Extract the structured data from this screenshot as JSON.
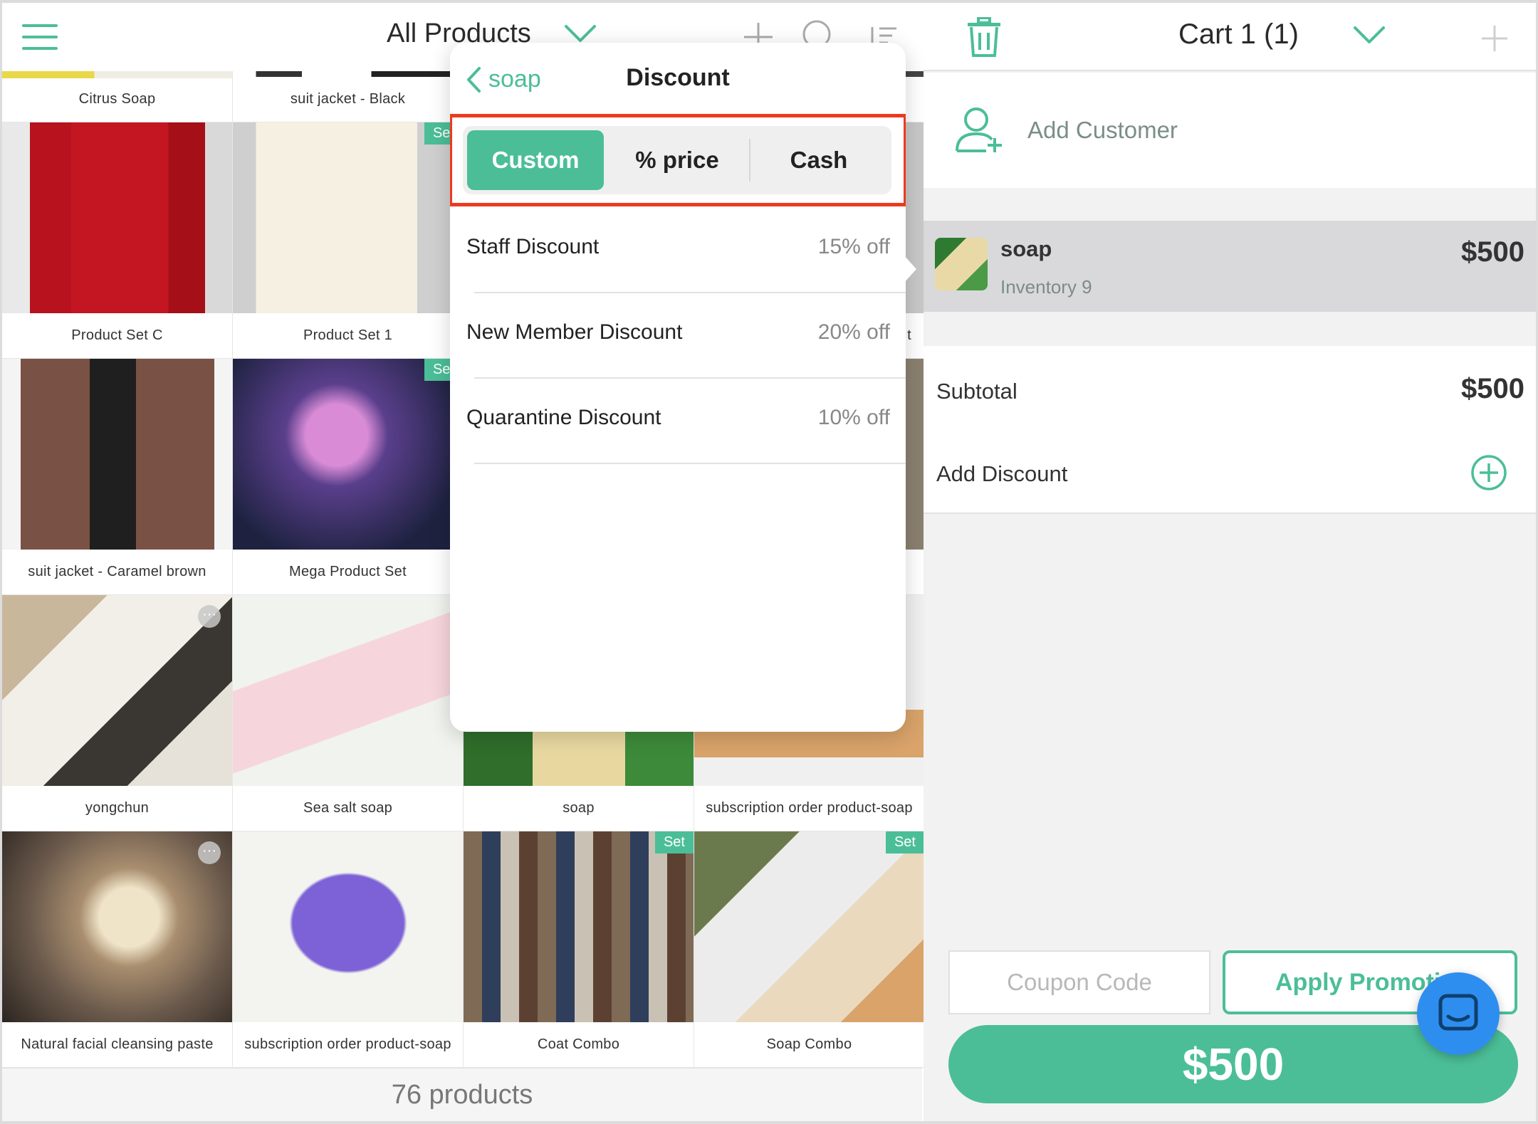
{
  "colors": {
    "accent": "#4bbe98",
    "highlight": "#ec3a1e",
    "chat": "#2e8ef0"
  },
  "header": {
    "title": "All Products",
    "icons": [
      "menu-icon",
      "chevron-down-icon",
      "plus-icon",
      "search-icon",
      "sort-icon"
    ]
  },
  "products": {
    "row0": [
      "Citrus Soap",
      "suit jacket - Black",
      "",
      ""
    ],
    "row1": [
      {
        "name": "Product Set C",
        "badge": ""
      },
      {
        "name": "Product Set 1",
        "badge": "Set"
      },
      {
        "name": "",
        "badge": ""
      },
      {
        "name": "t",
        "badge": ""
      }
    ],
    "row2": [
      {
        "name": "suit jacket - Caramel brown",
        "badge": ""
      },
      {
        "name": "Mega Product Set",
        "badge": "Set"
      },
      {
        "name": "",
        "badge": ""
      },
      {
        "name": "",
        "badge": ""
      }
    ],
    "row3": [
      {
        "name": "yongchun",
        "badge": ""
      },
      {
        "name": "Sea salt soap",
        "badge": ""
      },
      {
        "name": "soap",
        "badge": ""
      },
      {
        "name": "subscription order product-soap",
        "badge": ""
      }
    ],
    "row4": [
      {
        "name": "Natural facial cleansing paste",
        "badge": ""
      },
      {
        "name": "subscription order product-soap",
        "badge": ""
      },
      {
        "name": "Coat Combo",
        "badge": "Set"
      },
      {
        "name": "Soap Combo",
        "badge": "Set"
      }
    ],
    "count_label": "76 products"
  },
  "popover": {
    "back_label": "soap",
    "title": "Discount",
    "tabs": [
      "Custom",
      "% price",
      "Cash"
    ],
    "active_tab": "Custom",
    "discounts": [
      {
        "name": "Staff Discount",
        "value": "15% off"
      },
      {
        "name": "New Member Discount",
        "value": "20% off"
      },
      {
        "name": "Quarantine Discount",
        "value": "10% off"
      }
    ]
  },
  "cart": {
    "title": "Cart 1 (1)",
    "add_customer": "Add Customer",
    "item": {
      "name": "soap",
      "inventory": "Inventory 9",
      "price": "$500"
    },
    "subtotal_label": "Subtotal",
    "subtotal_value": "$500",
    "add_discount": "Add Discount",
    "coupon_placeholder": "Coupon Code",
    "apply_label": "Apply Promotion",
    "total": "$500"
  }
}
